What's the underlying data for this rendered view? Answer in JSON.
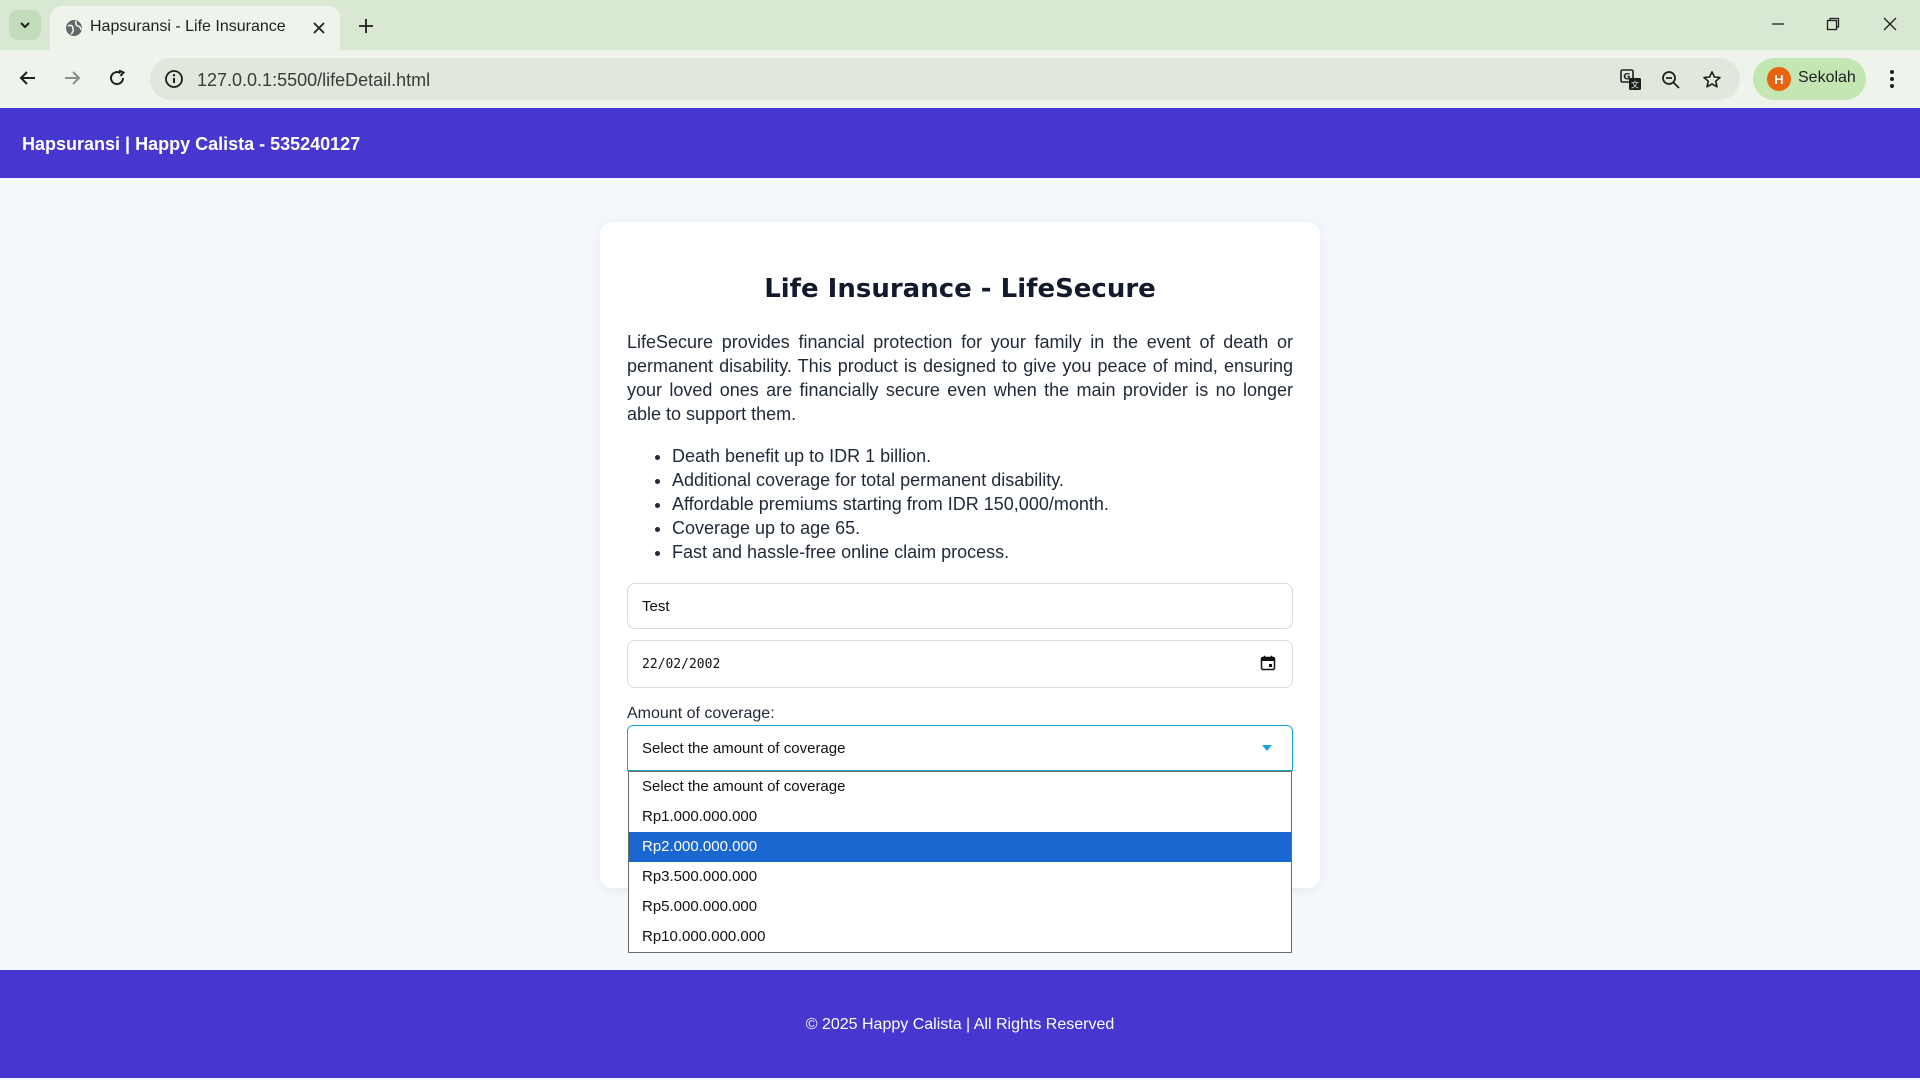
{
  "browser": {
    "tab_title": "Hapsuransi - Life Insurance",
    "url": "127.0.0.1:5500/lifeDetail.html",
    "profile_initial": "H",
    "profile_name": "Sekolah"
  },
  "header": {
    "brand": "Hapsuransi | Happy Calista - 535240127"
  },
  "product": {
    "title": "Life Insurance - LifeSecure",
    "description": "LifeSecure provides financial protection for your family in the event of death or permanent disability. This product is designed to give you peace of mind, ensuring your loved ones are financially secure even when the main provider is no longer able to support them.",
    "features": [
      "Death benefit up to IDR 1 billion.",
      "Additional coverage for total permanent disability.",
      "Affordable premiums starting from IDR 150,000/month.",
      "Coverage up to age 65.",
      "Fast and hassle-free online claim process."
    ]
  },
  "form": {
    "name_value": "Test",
    "dob_value": "22/02/2002",
    "coverage_label": "Amount of coverage:",
    "coverage_selected": "Select the amount of coverage",
    "coverage_options": [
      "Select the amount of coverage",
      "Rp1.000.000.000",
      "Rp2.000.000.000",
      "Rp3.500.000.000",
      "Rp5.000.000.000",
      "Rp10.000.000.000"
    ],
    "highlighted_option": "Rp2.000.000.000"
  },
  "footer": {
    "text": "© 2025 Happy Calista | All Rights Reserved"
  },
  "colors": {
    "brand": "#4537cf",
    "focus": "#19a7d6",
    "option_highlight": "#1a67d2"
  }
}
